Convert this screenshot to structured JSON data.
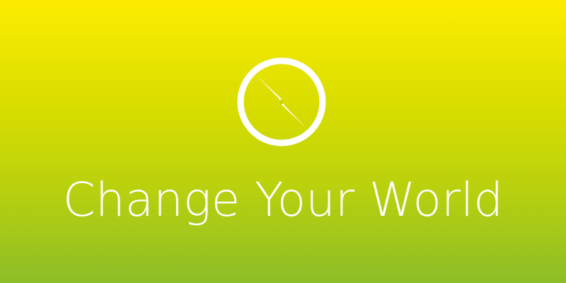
{
  "banner": {
    "title": "Change Your World",
    "icon": "compass-icon",
    "colors": {
      "gradient_top": "#fdec00",
      "gradient_bottom": "#8dbd28",
      "foreground": "#ffffff"
    }
  }
}
